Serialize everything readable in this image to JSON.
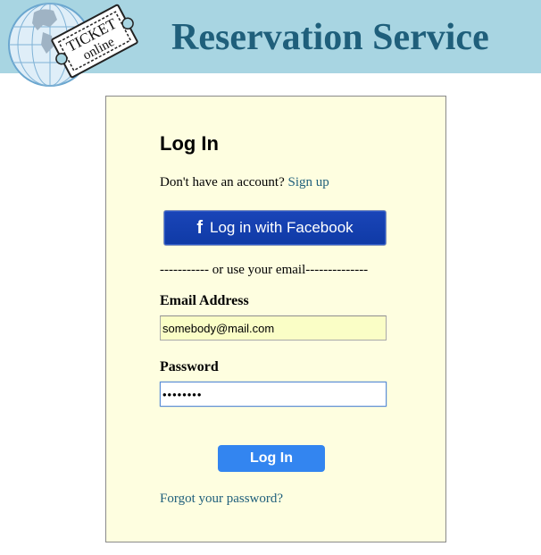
{
  "header": {
    "title": "Reservation Service",
    "logo": {
      "ticket_line1": "TICKET",
      "ticket_line2": "online",
      "icon": "globe-ticket-logo"
    }
  },
  "login": {
    "title": "Log In",
    "no_account_text": "Don't have an account?",
    "signup_link": "Sign up",
    "facebook_icon": "f",
    "facebook_button": "Log in with Facebook",
    "divider": "----------- or use your email--------------",
    "email_label": "Email Address",
    "email_value": "somebody@mail.com",
    "password_label": "Password",
    "password_value": "••••••••",
    "submit_button": "Log In",
    "forgot_link": "Forgot your password?"
  },
  "colors": {
    "header_bg": "#a8d5e2",
    "title": "#1f5f7b",
    "panel_bg": "#fefee0",
    "facebook_button": "#1440ae",
    "login_button": "#3385f0",
    "link": "#1f5f7b",
    "email_autofill_bg": "#fafec6"
  }
}
